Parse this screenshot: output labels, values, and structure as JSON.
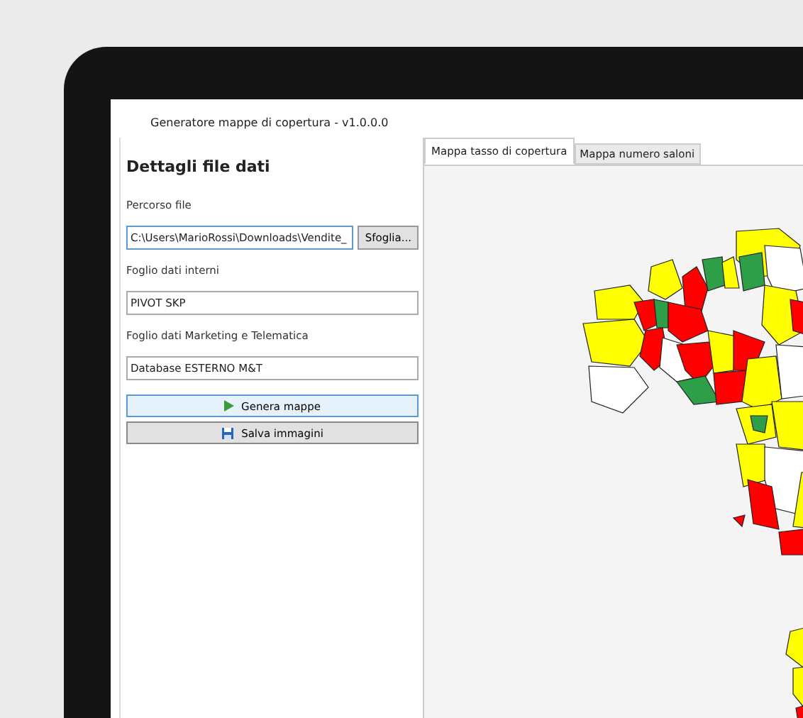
{
  "window": {
    "title": "Generatore mappe di copertura - v1.0.0.0"
  },
  "panel": {
    "heading": "Dettagli file dati",
    "fields": [
      {
        "label": "Percorso file",
        "value": "C:\\Users\\MarioRossi\\Downloads\\Vendite_",
        "button": "Sfoglia..."
      },
      {
        "label": "Foglio dati interni",
        "value": "PIVOT SKP"
      },
      {
        "label": "Foglio dati Marketing e Telematica",
        "value": "Database ESTERNO M&T"
      }
    ],
    "buttons": [
      {
        "kind": "run",
        "label": "Genera mappe"
      },
      {
        "kind": "save",
        "label": "Salva immagini"
      }
    ]
  },
  "tabs": [
    {
      "label": "Mappa tasso di copertura",
      "selected": true
    },
    {
      "label": "Mappa numero saloni",
      "selected": false
    }
  ]
}
